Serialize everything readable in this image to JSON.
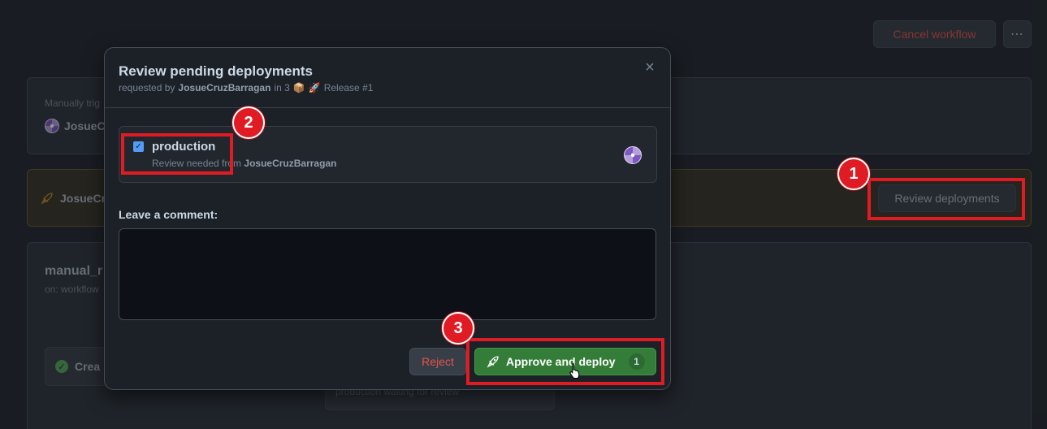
{
  "background": {
    "cancel_workflow_label": "Cancel workflow",
    "more_label": "⋯",
    "trigger": {
      "label": "Manually trig",
      "user": "JosueCr"
    },
    "waiting": {
      "user": "JosueCr",
      "review_button_label": "Review deployments"
    },
    "workflow": {
      "name": "manual_r",
      "on": "on: workflow",
      "job_label": "Crea",
      "production_status": "production waiting for review"
    }
  },
  "modal": {
    "title": "Review pending deployments",
    "subtitle": {
      "prefix": "requested by",
      "user": "JosueCruzBarragan",
      "in_text": "in 3",
      "package_icon": "📦",
      "rocket_icon": "🚀",
      "release": "Release #1"
    },
    "close_label": "×",
    "environment": {
      "name": "production",
      "checked": true,
      "review_prefix": "Review needed from",
      "reviewer": "JosueCruzBarragan"
    },
    "comment": {
      "label": "Leave a comment:",
      "value": ""
    },
    "reject_label": "Reject",
    "approve_label": "Approve and deploy",
    "approve_count": "1"
  },
  "annotations": {
    "step1": "1",
    "step2": "2",
    "step3": "3",
    "color": "#e01b24"
  },
  "colors": {
    "page_bg": "#22272e",
    "modal_bg": "#1c2128",
    "approve_green": "#347d39",
    "danger_red": "#e5534b"
  }
}
